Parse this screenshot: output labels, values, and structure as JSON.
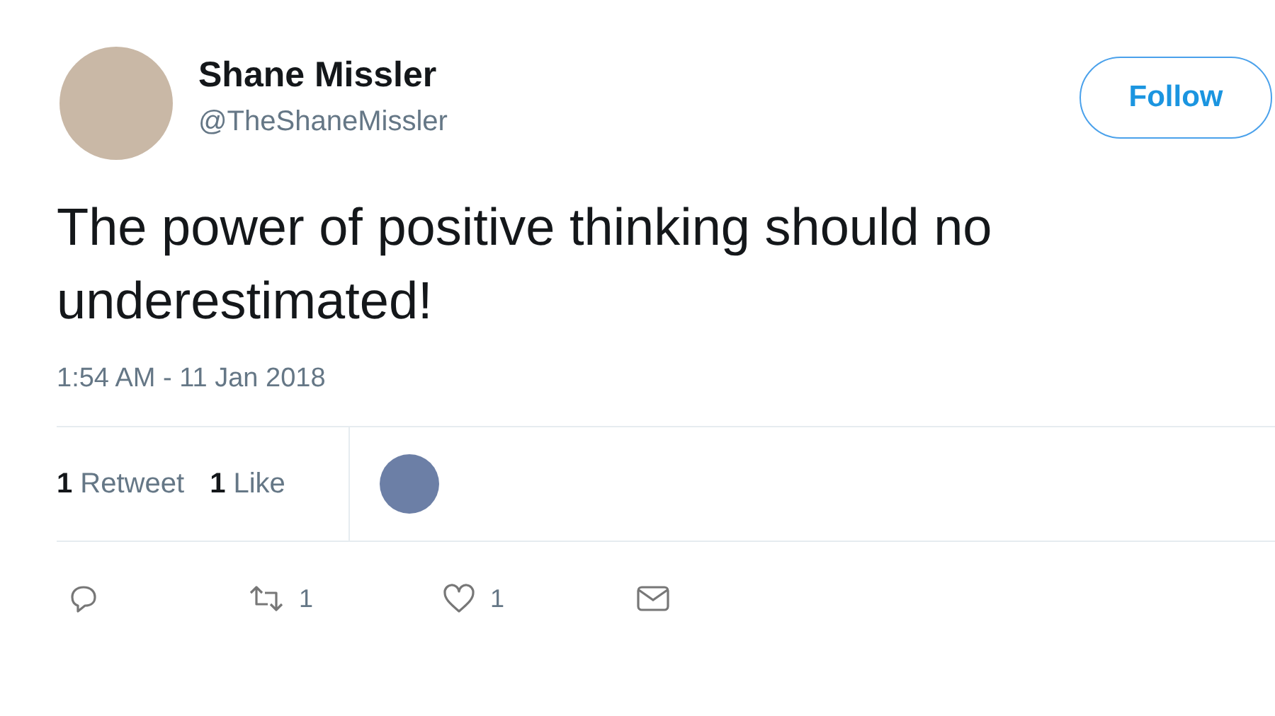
{
  "author": {
    "name": "Shane Missler",
    "handle": "@TheShaneMissler"
  },
  "follow_button": {
    "label": "Follow"
  },
  "text_lines": [
    "The power of positive thinking should no",
    "underestimated!"
  ],
  "timestamp": "1:54 AM - 11 Jan 2018",
  "stats": [
    {
      "count": "1",
      "label": "Retweet"
    },
    {
      "count": "1",
      "label": "Like"
    }
  ],
  "actions": [
    {
      "kind": "reply"
    },
    {
      "kind": "retweet",
      "count": "1"
    },
    {
      "kind": "like",
      "count": "1"
    },
    {
      "kind": "message"
    }
  ]
}
